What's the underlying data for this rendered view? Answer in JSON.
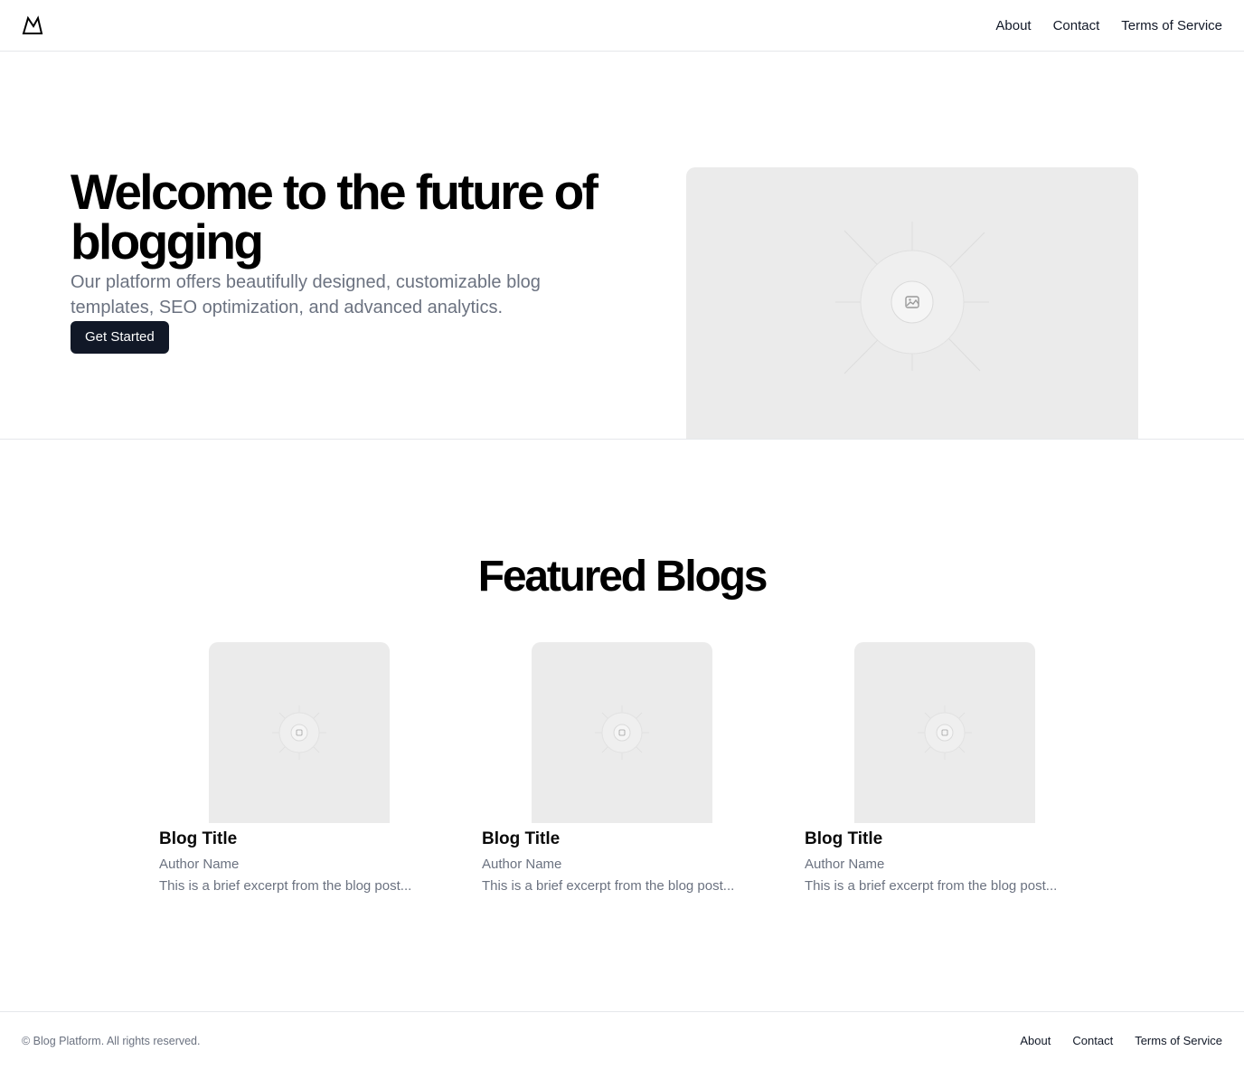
{
  "header": {
    "logo_icon": "mountain-logo-icon",
    "nav": [
      {
        "label": "About"
      },
      {
        "label": "Contact"
      },
      {
        "label": "Terms of Service"
      }
    ]
  },
  "hero": {
    "title": "Welcome to the future of blogging",
    "subtitle": "Our platform offers beautifully designed, customizable blog templates, SEO optimization, and advanced analytics.",
    "cta_label": "Get Started",
    "image_icon": "image-placeholder-icon"
  },
  "featured": {
    "title": "Featured Blogs",
    "cards": [
      {
        "title": "Blog Title",
        "author": "Author Name",
        "excerpt": "This is a brief excerpt from the blog post..."
      },
      {
        "title": "Blog Title",
        "author": "Author Name",
        "excerpt": "This is a brief excerpt from the blog post..."
      },
      {
        "title": "Blog Title",
        "author": "Author Name",
        "excerpt": "This is a brief excerpt from the blog post..."
      }
    ]
  },
  "footer": {
    "copyright": "© Blog Platform. All rights reserved.",
    "nav": [
      {
        "label": "About"
      },
      {
        "label": "Contact"
      },
      {
        "label": "Terms of Service"
      }
    ]
  },
  "colors": {
    "primary_button": "#111827",
    "muted_text": "#6b7280",
    "placeholder_bg": "#ebebeb",
    "border": "#e5e7eb"
  }
}
